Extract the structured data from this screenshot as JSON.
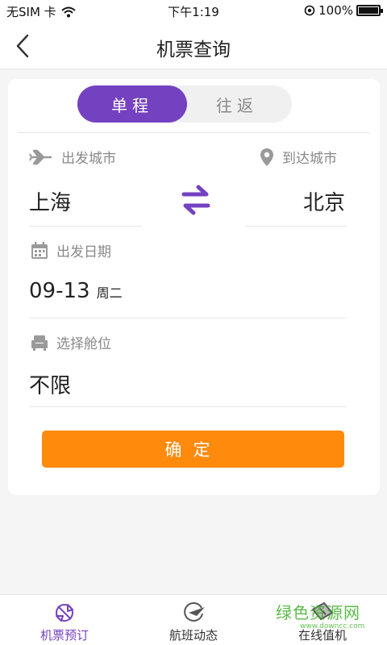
{
  "status_bar": {
    "carrier": "无SIM 卡",
    "time": "下午1:19",
    "battery": "100%"
  },
  "nav": {
    "title": "机票查询"
  },
  "trip_type": {
    "one_way": "单程",
    "round_trip": "往返",
    "selected": "单程"
  },
  "departure": {
    "label": "出发城市",
    "city": "上海"
  },
  "arrival": {
    "label": "到达城市",
    "city": "北京"
  },
  "date": {
    "label": "出发日期",
    "value": "09-13",
    "weekday": "周二"
  },
  "cabin": {
    "label": "选择舱位",
    "value": "不限"
  },
  "confirm_label": "确定",
  "tabs": [
    {
      "label": "机票预订",
      "icon": "airplane-booking-icon",
      "active": true
    },
    {
      "label": "航班动态",
      "icon": "flight-status-icon",
      "active": false
    },
    {
      "label": "在线值机",
      "icon": "online-checkin-icon",
      "active": false
    }
  ],
  "watermark": {
    "text": "绿色资源网",
    "sub": "www.downcc.com"
  },
  "colors": {
    "accent": "#7442c0",
    "confirm": "#ff8a0c",
    "watermark": "#3fae2a"
  }
}
